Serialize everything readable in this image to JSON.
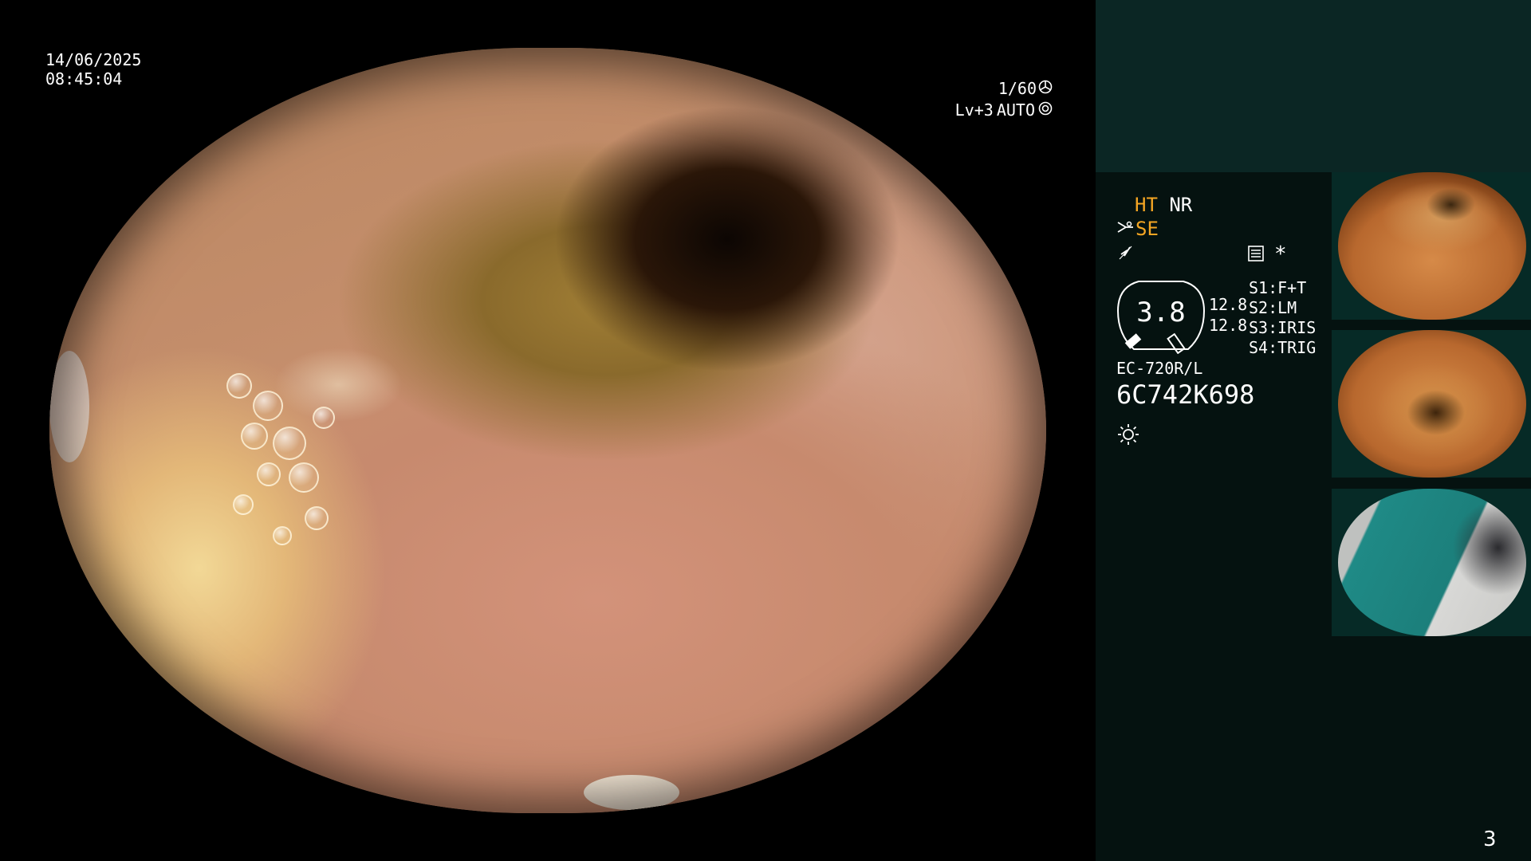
{
  "overlay": {
    "date": "14/06/2025",
    "time": "08:45:04",
    "shutter": "1/60",
    "brightness": "Lv+3",
    "iris_mode": "AUTO"
  },
  "side_panel": {
    "mode_ht": "HT",
    "mode_nr": "NR",
    "mode_se": "SE",
    "zoom_value": "3.8",
    "scale_top": "12.8",
    "scale_bottom": "12.8",
    "switches": [
      "S1:F+T",
      "S2:LM",
      "S3:IRIS",
      "S4:TRIG"
    ],
    "scope_model": "EC-720R/L",
    "serial": "6C742K698",
    "frame_number": "3",
    "icons": [
      "scissors-icon",
      "lightning-icon",
      "memo-icon",
      "asterisk-icon",
      "light-source-icon",
      "shutter-icon",
      "iris-icon"
    ]
  },
  "colors": {
    "accent_orange": "#f5a623",
    "panel_dark": "#051210",
    "panel_top": "#0b2624"
  }
}
